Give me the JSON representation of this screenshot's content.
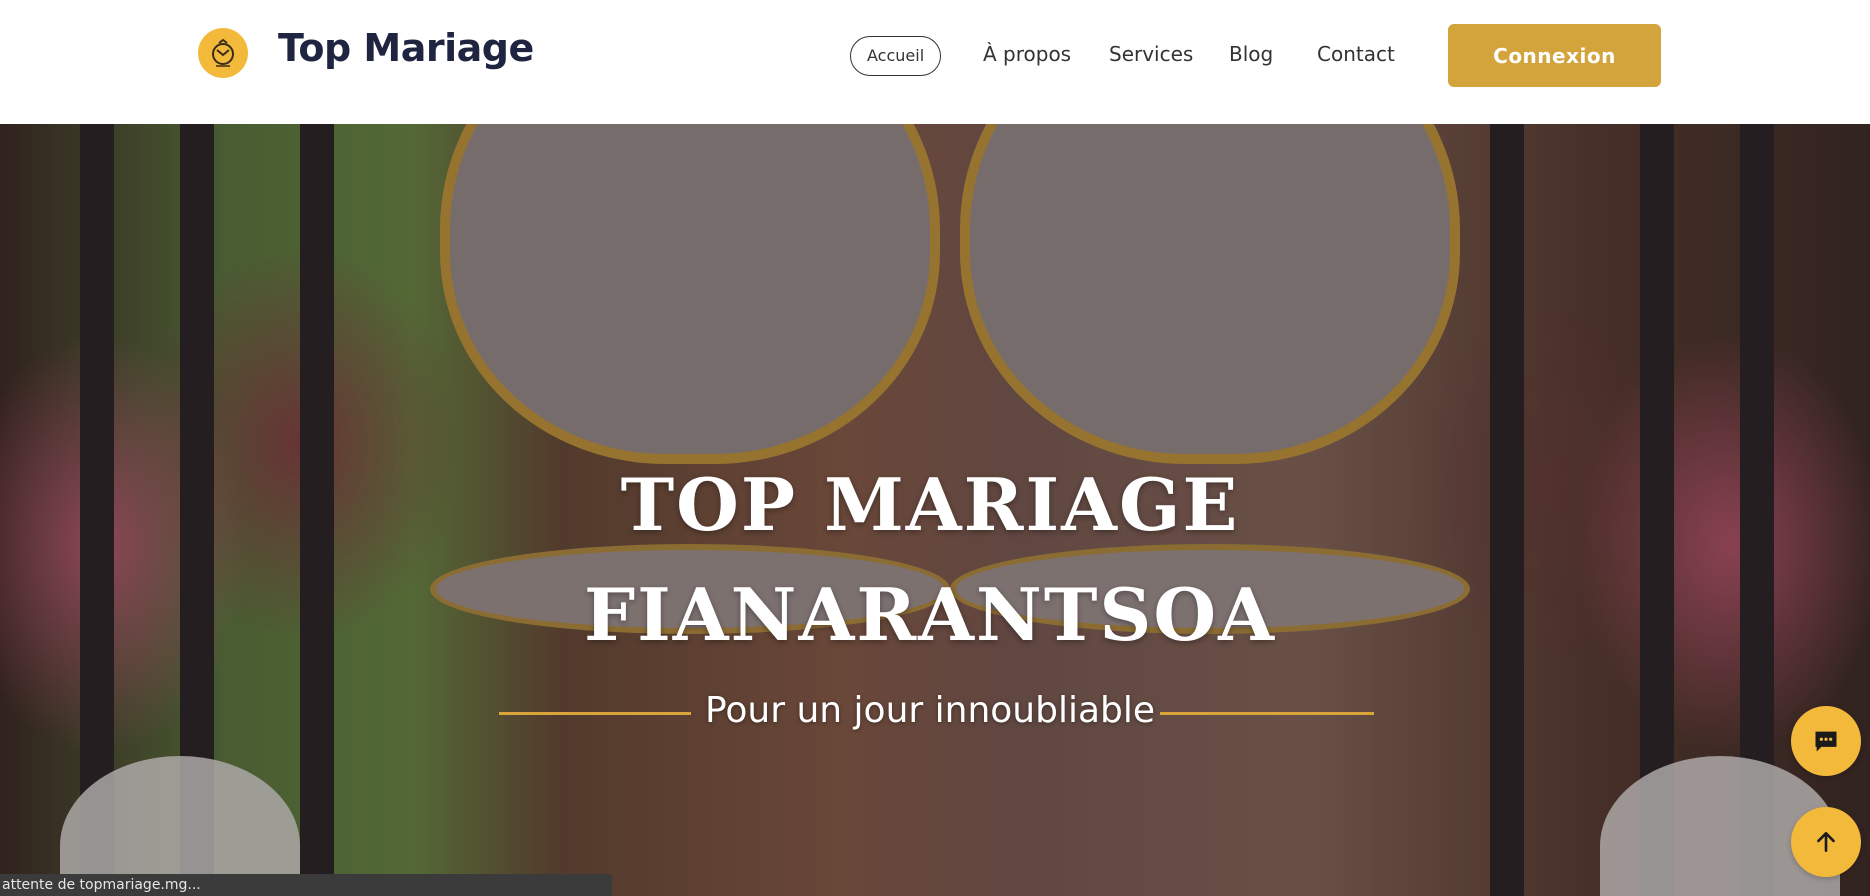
{
  "header": {
    "brand": "Top Mariage",
    "logo_icon": "ring-envelope-icon",
    "nav": [
      {
        "label": "Accueil",
        "active": true
      },
      {
        "label": "À propos",
        "active": false
      },
      {
        "label": "Services",
        "active": false
      },
      {
        "label": "Blog",
        "active": false
      },
      {
        "label": "Contact",
        "active": false
      }
    ],
    "login_label": "Connexion"
  },
  "hero": {
    "title_line1": "TOP MARIAGE",
    "title_line2": "FIANARANTSOA",
    "subtitle": "Pour un jour innoubliable"
  },
  "floating": {
    "chat_icon": "chat-bubble-icon",
    "top_icon": "arrow-up-icon"
  },
  "status": {
    "text": "attente de topmariage.mg..."
  },
  "colors": {
    "accent": "#f2b93b",
    "button": "#d3a33c",
    "brand_text": "#1f2440",
    "divider": "#d9a43a"
  }
}
